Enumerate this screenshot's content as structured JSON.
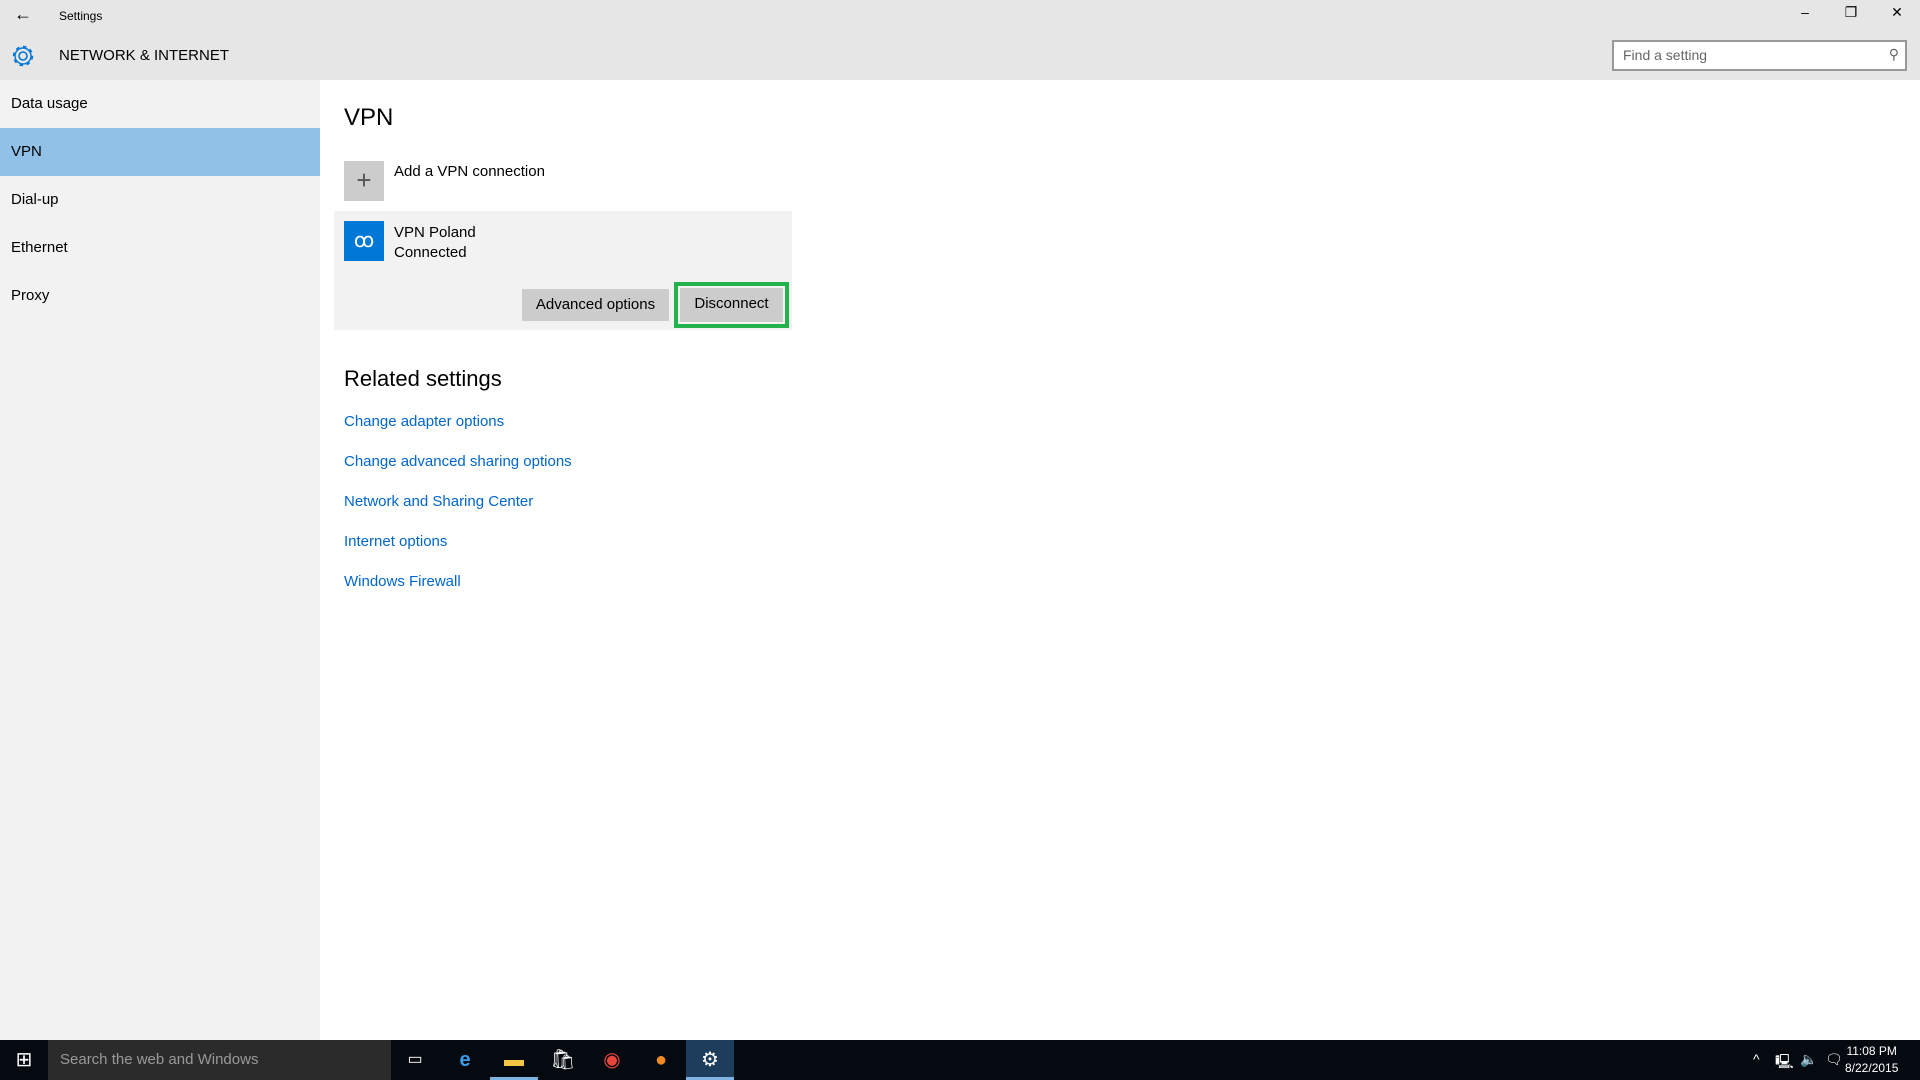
{
  "window": {
    "title": "Settings",
    "back_icon": "arrow-left-icon",
    "minimize": "–",
    "restore": "❐",
    "close": "✕"
  },
  "header": {
    "section": "NETWORK & INTERNET",
    "search_placeholder": "Find a setting"
  },
  "sidebar": {
    "items": [
      {
        "label": "Data usage"
      },
      {
        "label": "VPN",
        "active": true
      },
      {
        "label": "Dial-up"
      },
      {
        "label": "Ethernet"
      },
      {
        "label": "Proxy"
      }
    ]
  },
  "main": {
    "title": "VPN",
    "add_label": "Add a VPN connection",
    "connection": {
      "name": "VPN Poland",
      "status": "Connected",
      "advanced_label": "Advanced options",
      "disconnect_label": "Disconnect"
    },
    "related_title": "Related settings",
    "links": [
      "Change adapter options",
      "Change advanced sharing options",
      "Network and Sharing Center",
      "Internet options",
      "Windows Firewall"
    ]
  },
  "taskbar": {
    "search_placeholder": "Search the web and Windows",
    "time": "11:08 PM",
    "date": "8/22/2015"
  },
  "colors": {
    "accent": "#0078d7",
    "selected": "#91c1e7",
    "highlight": "#21b24b",
    "link": "#0066cc"
  }
}
